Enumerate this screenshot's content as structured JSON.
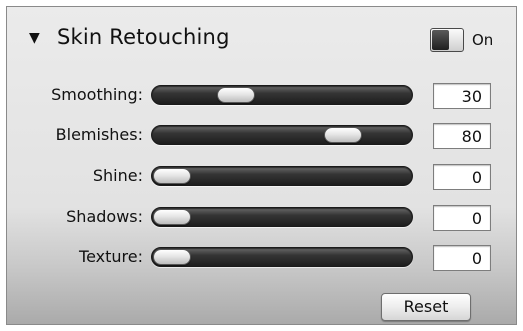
{
  "panel": {
    "disclosure_glyph": "▼",
    "title": "Skin Retouching",
    "toggle": {
      "state": "on",
      "label": "On"
    }
  },
  "sliders": [
    {
      "label": "Smoothing:",
      "value": "30",
      "fraction": 0.3
    },
    {
      "label": "Blemishes:",
      "value": "80",
      "fraction": 0.8
    },
    {
      "label": "Shine:",
      "value": "0",
      "fraction": 0.0
    },
    {
      "label": "Shadows:",
      "value": "0",
      "fraction": 0.0
    },
    {
      "label": "Texture:",
      "value": "0",
      "fraction": 0.0
    }
  ],
  "reset_label": "Reset",
  "colors": {
    "track": "#1d1d1d",
    "panel_bg": "#e2e2e2"
  }
}
